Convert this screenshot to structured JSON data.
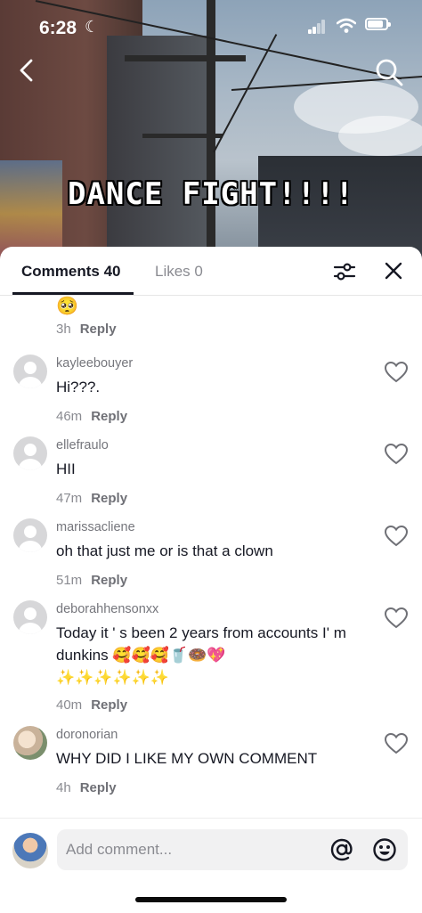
{
  "status_bar": {
    "time": "6:28",
    "battery_level": 0.85
  },
  "video": {
    "overlay_text": "DANCE FIGHT!!!!"
  },
  "tabs": {
    "comments": "Comments 40",
    "likes": "Likes 0"
  },
  "comments": [
    {
      "username": "",
      "text": "🥺",
      "time": "3h",
      "reply_label": "Reply",
      "avatar": "none"
    },
    {
      "username": "kayleebouyer",
      "text": "Hi???.",
      "time": "46m",
      "reply_label": "Reply",
      "avatar": "default-avatar-icon"
    },
    {
      "username": "ellefraulo",
      "text": "HII",
      "time": "47m",
      "reply_label": "Reply",
      "avatar": "default-avatar-icon"
    },
    {
      "username": "marissacliene",
      "text": "oh that just me or is that a clown",
      "time": "51m",
      "reply_label": "Reply",
      "avatar": "default-avatar-icon"
    },
    {
      "username": "deborahhensonxx",
      "text_line1": "Today it ' s been 2 years from accounts I' m",
      "text_line2": "dunkins 🥰🥰🥰🥤🍩💖",
      "text_line3": "✨✨✨✨✨✨",
      "time": "40m",
      "reply_label": "Reply",
      "avatar": "default-avatar-icon"
    },
    {
      "username": "doronorian",
      "text": "WHY DID I LIKE MY OWN COMMENT",
      "time": "4h",
      "reply_label": "Reply",
      "avatar": "photo"
    }
  ],
  "input": {
    "placeholder": "Add comment..."
  },
  "colors": {
    "accent": "#161823",
    "muted": "#8a8b91",
    "sheet_bg": "#ffffff",
    "input_bg": "#f1f1f2"
  },
  "icons": [
    "back-arrow-icon",
    "search-icon",
    "filter-icon",
    "close-icon",
    "heart-icon",
    "at-icon",
    "emoji-icon",
    "moon-icon",
    "signal-icon",
    "wifi-icon",
    "battery-icon"
  ]
}
